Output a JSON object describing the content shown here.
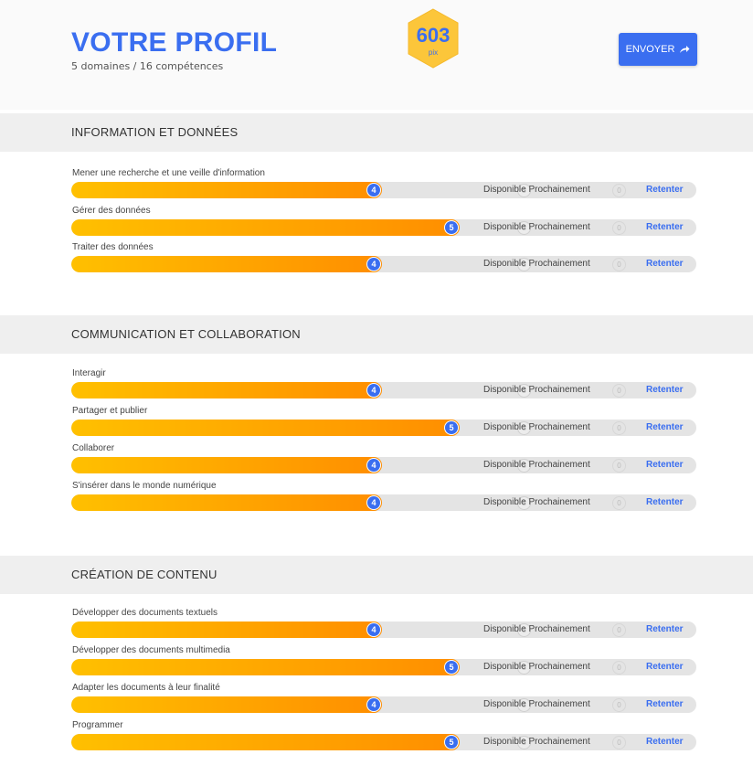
{
  "header": {
    "title": "VOTRE PROFIL",
    "subtitle": "5 domaines / 16 compétences",
    "pix_score": "603",
    "pix_unit": "pix",
    "send_label": "ENVOYER"
  },
  "status_label": "Disponible Prochainement",
  "retry_label": "Retenter",
  "max_level": "5",
  "next_level_placeholder": "0",
  "colors": {
    "accent": "#3a6ef0",
    "badge": "#fcc63a",
    "bar_start": "#ffc000",
    "bar_end": "#ff8e00"
  },
  "sections": [
    {
      "title": "INFORMATION ET DONNÉES",
      "competences": [
        {
          "label": "Mener une recherche et une veille d'information",
          "level": 4
        },
        {
          "label": "Gérer des données",
          "level": 5
        },
        {
          "label": "Traiter des données",
          "level": 4
        }
      ]
    },
    {
      "title": "COMMUNICATION ET COLLABORATION",
      "competences": [
        {
          "label": "Interagir",
          "level": 4
        },
        {
          "label": "Partager et publier",
          "level": 5
        },
        {
          "label": "Collaborer",
          "level": 4
        },
        {
          "label": "S'insérer dans le monde numérique",
          "level": 4
        }
      ]
    },
    {
      "title": "CRÉATION DE CONTENU",
      "competences": [
        {
          "label": "Développer des documents textuels",
          "level": 4
        },
        {
          "label": "Développer des documents multimedia",
          "level": 5
        },
        {
          "label": "Adapter les documents à leur finalité",
          "level": 4
        },
        {
          "label": "Programmer",
          "level": 5
        }
      ]
    }
  ]
}
